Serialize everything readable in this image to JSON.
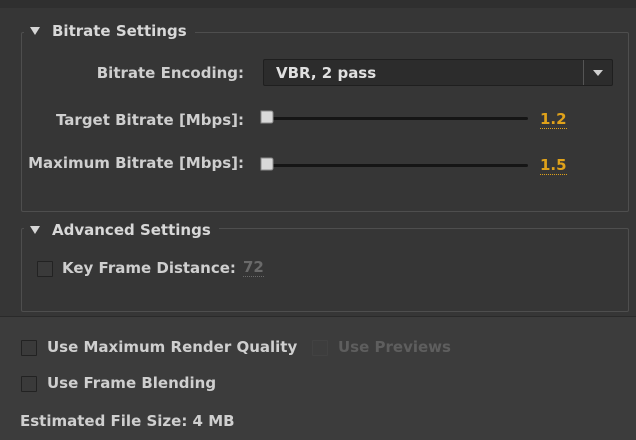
{
  "bitrate_settings": {
    "title": "Bitrate Settings",
    "encoding_label": "Bitrate Encoding:",
    "encoding_value": "VBR, 2 pass",
    "target_label": "Target Bitrate [Mbps]:",
    "target_value": "1.2",
    "max_label": "Maximum Bitrate [Mbps]:",
    "max_value": "1.5"
  },
  "advanced_settings": {
    "title": "Advanced Settings",
    "keyframe_label": "Key Frame Distance:",
    "keyframe_value": "72",
    "keyframe_checked": false
  },
  "options": {
    "max_render_quality_label": "Use Maximum Render Quality",
    "use_previews_label": "Use Previews",
    "frame_blending_label": "Use Frame Blending"
  },
  "footer": {
    "file_size_text": "Estimated File Size:  4 MB"
  },
  "colors": {
    "accent": "#e0a21a",
    "panel_bg": "#363636",
    "text": "#cfcfcf"
  },
  "icons": {
    "collapse": "triangle-down-icon",
    "dropdown": "chevron-down-icon",
    "slider_thumb": "slider-thumb-icon"
  }
}
